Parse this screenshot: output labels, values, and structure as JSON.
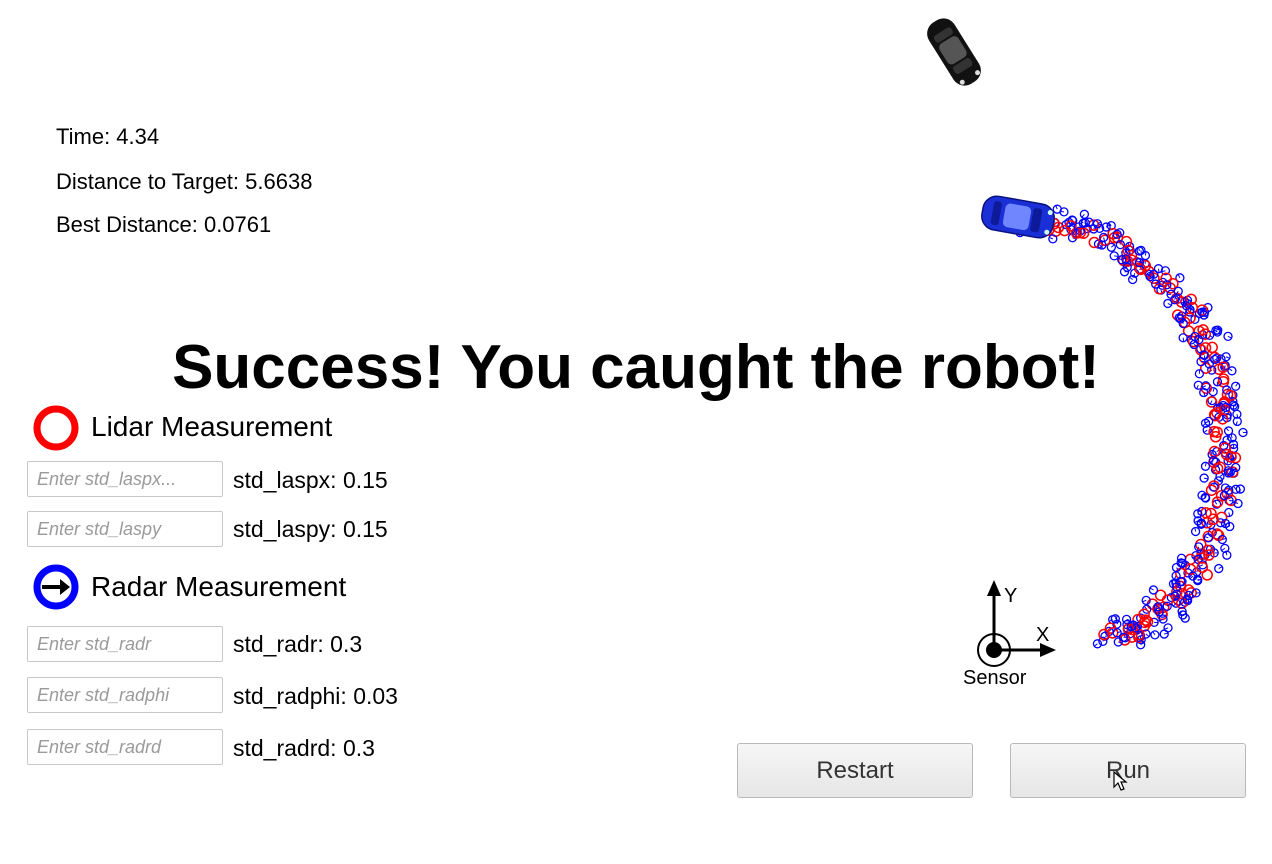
{
  "stats": {
    "time": "Time: 4.34",
    "distance_to_target": "Distance to Target: 5.6638",
    "best_distance": "Best Distance: 0.0761"
  },
  "banner": "Success! You caught the robot!",
  "legend": {
    "lidar_label": "Lidar Measurement",
    "radar_label": "Radar Measurement",
    "lidar_color": "#ff0000",
    "radar_color": "#0000ff"
  },
  "params": [
    {
      "placeholder": "Enter std_laspx...",
      "label": "std_laspx: 0.15"
    },
    {
      "placeholder": "Enter std_laspy",
      "label": "std_laspy: 0.15"
    },
    {
      "placeholder": "Enter std_radr",
      "label": "std_radr: 0.3"
    },
    {
      "placeholder": "Enter std_radphi",
      "label": "std_radphi: 0.03"
    },
    {
      "placeholder": "Enter std_radrd",
      "label": "std_radrd: 0.3"
    }
  ],
  "sensor": {
    "x_label": "X",
    "y_label": "Y",
    "label": "Sensor"
  },
  "buttons": {
    "restart": "Restart",
    "run": "Run"
  },
  "icons": {
    "lidar": "lidar-ring-icon",
    "radar": "radar-arrow-icon",
    "hunter_car": "black-car-icon",
    "target_car": "blue-car-icon",
    "cursor": "mouse-cursor-icon"
  }
}
